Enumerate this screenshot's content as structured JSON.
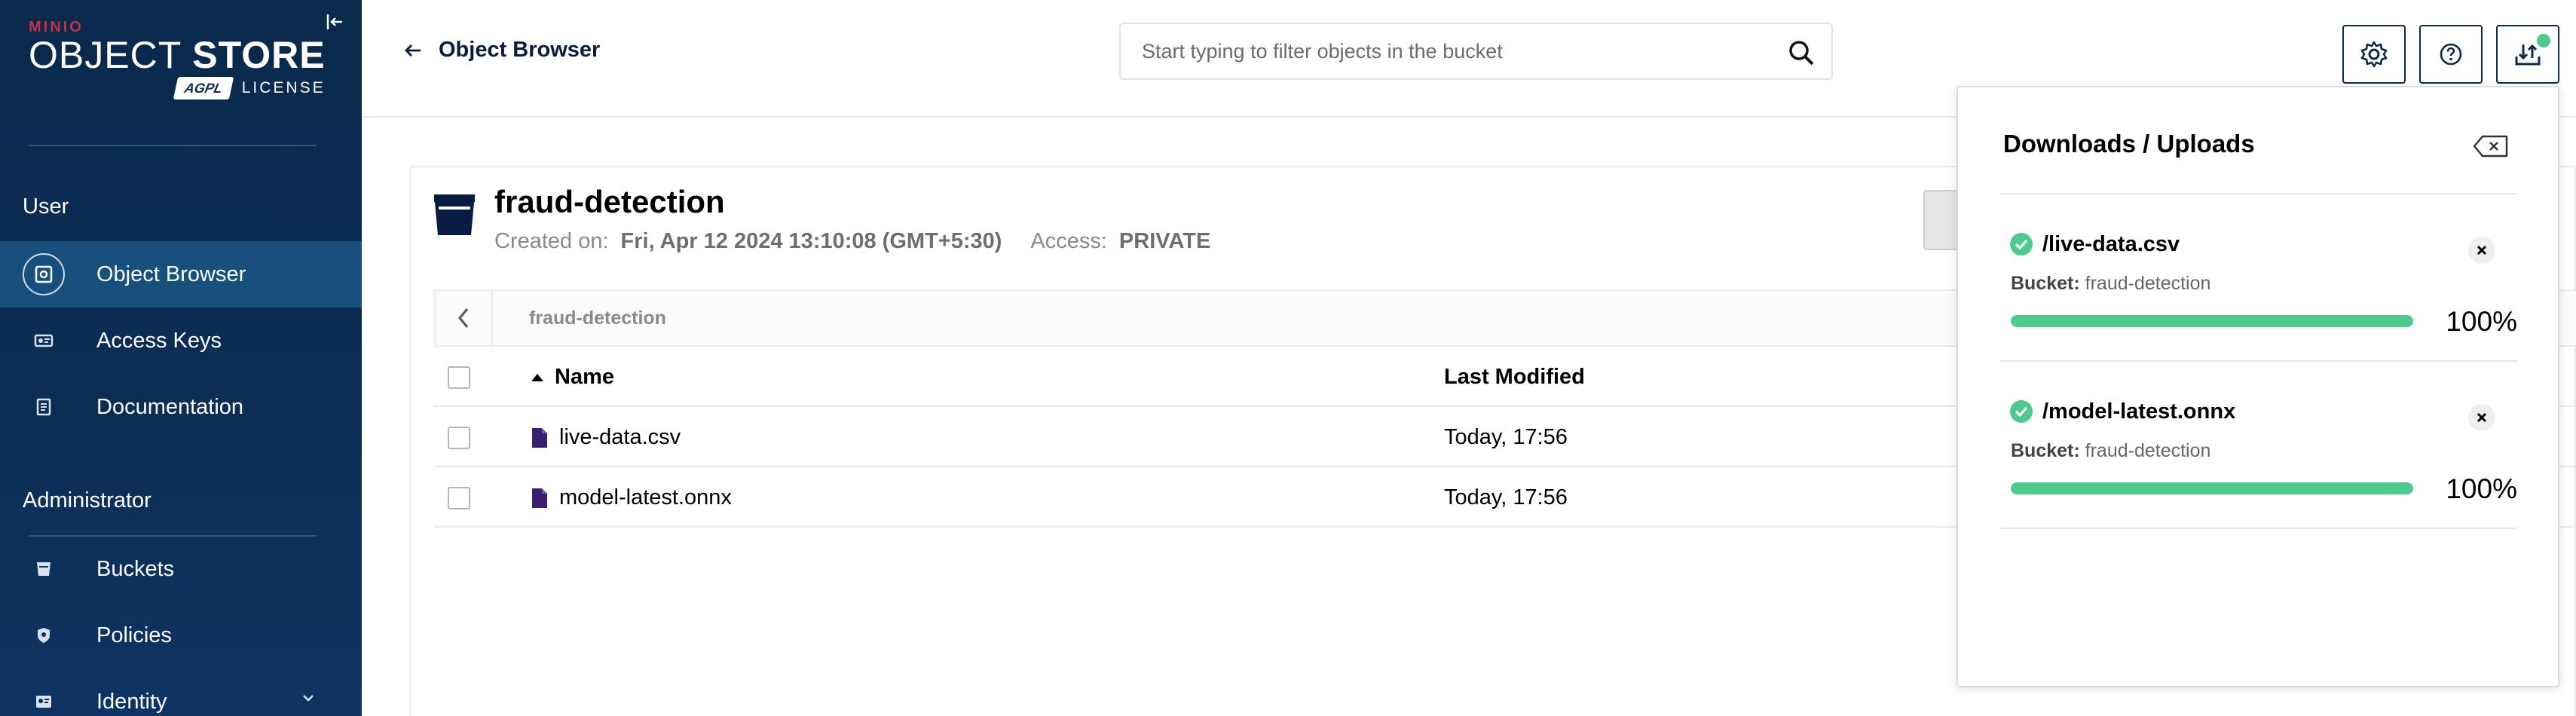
{
  "brand": {
    "vendor": "MINIO",
    "product_light": "OBJECT",
    "product_bold": "STORE",
    "license_badge": "AGPL",
    "license_label": "LICENSE"
  },
  "sidebar": {
    "sections": [
      {
        "title": "User",
        "items": [
          {
            "label": "Object Browser",
            "icon": "object-browser-icon",
            "active": true
          },
          {
            "label": "Access Keys",
            "icon": "access-keys-icon",
            "active": false
          },
          {
            "label": "Documentation",
            "icon": "documentation-icon",
            "active": false
          }
        ]
      },
      {
        "title": "Administrator",
        "items": [
          {
            "label": "Buckets",
            "icon": "bucket-icon",
            "active": false
          },
          {
            "label": "Policies",
            "icon": "policy-shield-icon",
            "active": false
          },
          {
            "label": "Identity",
            "icon": "identity-icon",
            "active": false,
            "expandable": true
          }
        ]
      }
    ]
  },
  "header": {
    "back_label": "Object Browser",
    "search_placeholder": "Start typing to filter objects in the bucket",
    "buttons": [
      "settings-gear-icon",
      "help-icon",
      "downloads-uploads-icon"
    ]
  },
  "bucket": {
    "name": "fraud-detection",
    "created_label": "Created on:",
    "created_value": "Fri, Apr 12 2024 13:10:08 (GMT+5:30)",
    "access_label": "Access:",
    "access_value": "PRIVATE",
    "breadcrumb": "fraud-detection"
  },
  "table": {
    "headers": {
      "name": "Name",
      "modified": "Last Modified"
    },
    "rows": [
      {
        "name": "live-data.csv",
        "modified": "Today, 17:56"
      },
      {
        "name": "model-latest.onnx",
        "modified": "Today, 17:56"
      }
    ]
  },
  "panel": {
    "title": "Downloads / Uploads",
    "items": [
      {
        "path": "/live-data.csv",
        "bucket_label": "Bucket:",
        "bucket": "fraud-detection",
        "progress": 100,
        "progress_text": "100%"
      },
      {
        "path": "/model-latest.onnx",
        "bucket_label": "Bucket:",
        "bucket": "fraud-detection",
        "progress": 100,
        "progress_text": "100%"
      }
    ]
  },
  "colors": {
    "sidebar": "#0c2e55",
    "active_nav": "#17507d",
    "progress": "#4ccb8d",
    "accent_red": "#c72c48",
    "file_icon": "#3b1f6e"
  }
}
